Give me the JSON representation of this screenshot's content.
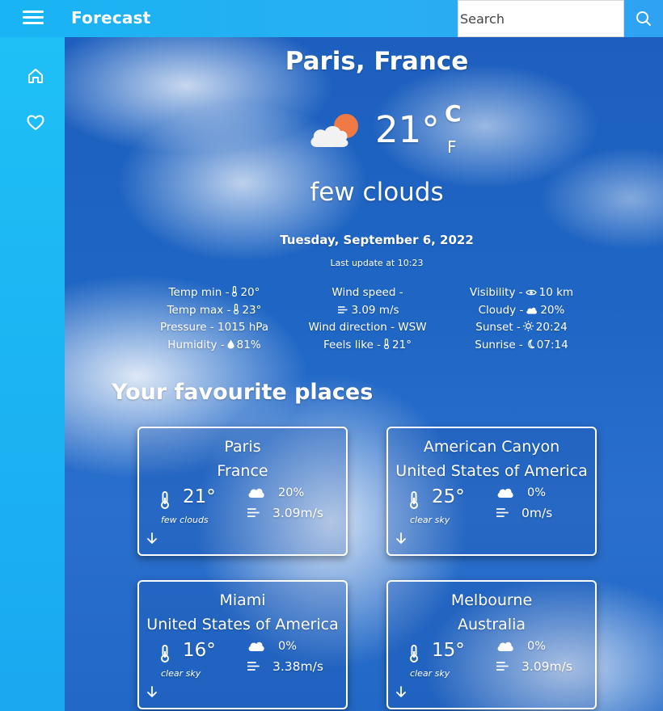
{
  "header": {
    "app_title": "Forecast",
    "search_placeholder": "Search",
    "icons": {
      "menu": "menu-icon",
      "search": "search-icon"
    }
  },
  "sidebar": {
    "items": [
      {
        "icon": "home-icon"
      },
      {
        "icon": "heart-icon"
      }
    ]
  },
  "current": {
    "city": "Paris, France",
    "temperature": "21°",
    "unit_c": "C",
    "unit_f": "F",
    "description": "few clouds",
    "date": "Tuesday, September 6, 2022",
    "last_update": "Last update at 10:23",
    "details": {
      "temp_min": {
        "label": "Temp min -",
        "value": "20°"
      },
      "temp_max": {
        "label": "Temp max -",
        "value": "23°"
      },
      "pressure": {
        "label": "Pressure -",
        "value": "1015 hPa"
      },
      "humidity": {
        "label": "Humidity -",
        "value": "81%"
      },
      "wind_speed": {
        "label": "Wind speed -",
        "value": "3.09 m/s"
      },
      "wind_direction": {
        "label": "Wind direction -",
        "value": "WSW"
      },
      "feels_like": {
        "label": "Feels like -",
        "value": "21°"
      },
      "visibility": {
        "label": "Visibility -",
        "value": "10 km"
      },
      "cloudy": {
        "label": "Cloudy -",
        "value": "20%"
      },
      "sunset": {
        "label": "Sunset -",
        "value": "20:24"
      },
      "sunrise": {
        "label": "Sunrise -",
        "value": "07:14"
      }
    }
  },
  "favourites": {
    "title": "Your favourite places",
    "cards": [
      {
        "city": "Paris",
        "country": "France",
        "temp": "21°",
        "desc": "few clouds",
        "cloud": "20%",
        "wind": "3.09m/s"
      },
      {
        "city": "American Canyon",
        "country": "United States of America",
        "temp": "25°",
        "desc": "clear sky",
        "cloud": "0%",
        "wind": "0m/s"
      },
      {
        "city": "Miami",
        "country": "United States of America",
        "temp": "16°",
        "desc": "clear sky",
        "cloud": "0%",
        "wind": "3.38m/s"
      },
      {
        "city": "Melbourne",
        "country": "Australia",
        "temp": "15°",
        "desc": "clear sky",
        "cloud": "0%",
        "wind": "3.09m/s"
      }
    ]
  },
  "colors": {
    "topbar": "#1fb2f3",
    "sidebar": "#1ab9f5",
    "sky": "#1f66c4",
    "sun": "#f07a45"
  }
}
